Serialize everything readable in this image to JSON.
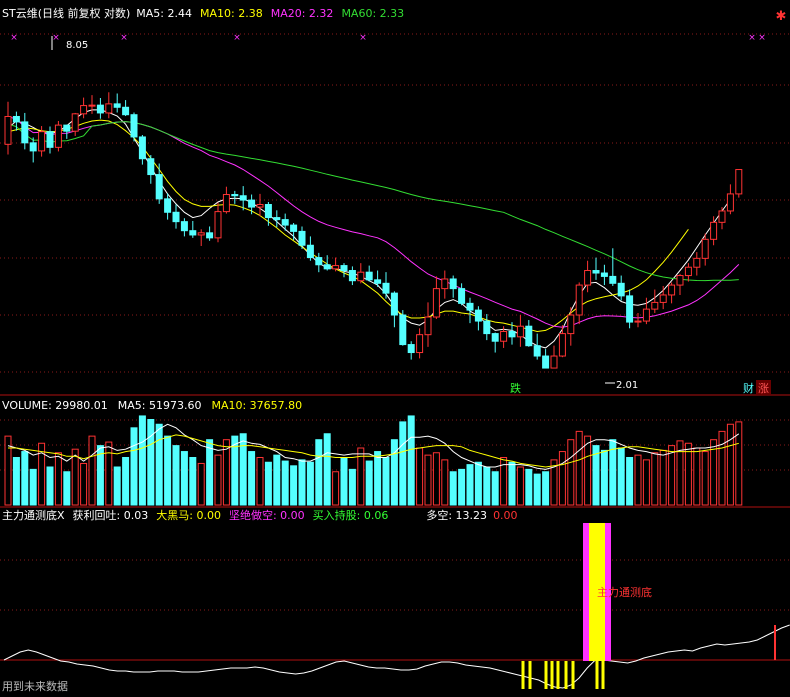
{
  "main_header": {
    "title": "ST云维(日线 前复权 对数)",
    "items": [
      {
        "label": "MA5: 2.44",
        "color": "#ffffff"
      },
      {
        "label": "MA10: 2.38",
        "color": "#ffff00"
      },
      {
        "label": "MA20: 2.32",
        "color": "#ff33ff"
      },
      {
        "label": "MA60: 2.33",
        "color": "#33dd33"
      }
    ]
  },
  "volume_header": {
    "items": [
      {
        "label": "VOLUME: 29980.01",
        "color": "#ffffff"
      },
      {
        "label": "MA5: 51973.60",
        "color": "#ffffff"
      },
      {
        "label": "MA10: 37657.80",
        "color": "#ffff00"
      }
    ]
  },
  "indicator_header": {
    "items": [
      {
        "label": "主力通测底X",
        "color": "#ffffff"
      },
      {
        "label": "获利回吐: 0.03",
        "color": "#ffffff"
      },
      {
        "label": "大黑马: 0.00",
        "color": "#ffff00"
      },
      {
        "label": "坚绝做空: 0.00",
        "color": "#ff33ff"
      },
      {
        "label": "买入持股: 0.06",
        "color": "#33ff33"
      },
      {
        "label": "多空: 13.23",
        "color": "#ffffff"
      },
      {
        "label": "0.00",
        "color": "#ff3333"
      }
    ]
  },
  "annotations": {
    "high_label": "8.05",
    "low_label": "2.01",
    "die_tag": "跌",
    "cai_tag": "财",
    "zhang_tag": "涨",
    "bar_label": "主力通测底",
    "footer": "用到未来数据"
  },
  "colors": {
    "up": "#ff3333",
    "down": "#54ffff",
    "ma5": "#ffffff",
    "ma10": "#ffff00",
    "ma20": "#ff33ff",
    "ma60": "#33dd33",
    "grid": "#8a1a1a",
    "divider": "#b01010",
    "magenta_bar": "#ff33ff",
    "yellow_bar": "#ffff00"
  },
  "chart_data": [
    {
      "type": "candlestick",
      "log_scale": true,
      "ylim": [
        1.9,
        8.6
      ],
      "candles": [
        [
          4.96,
          5.55,
          4.76,
          5.89
        ],
        [
          5.55,
          5.43,
          5.24,
          5.66
        ],
        [
          5.43,
          4.99,
          4.86,
          5.63
        ],
        [
          4.99,
          4.83,
          4.61,
          5.1
        ],
        [
          4.83,
          5.22,
          4.72,
          5.34
        ],
        [
          5.22,
          4.9,
          4.78,
          5.33
        ],
        [
          4.9,
          5.36,
          4.82,
          5.45
        ],
        [
          5.36,
          5.23,
          5.07,
          5.37
        ],
        [
          5.23,
          5.61,
          5.13,
          5.63
        ],
        [
          5.61,
          5.8,
          5.51,
          5.99
        ],
        [
          5.8,
          5.81,
          5.61,
          6.05
        ],
        [
          5.81,
          5.63,
          5.5,
          5.98
        ],
        [
          5.63,
          5.84,
          5.51,
          6.12
        ],
        [
          5.84,
          5.76,
          5.64,
          6.09
        ],
        [
          5.76,
          5.59,
          5.56,
          5.93
        ],
        [
          5.59,
          5.11,
          5.02,
          5.64
        ],
        [
          5.11,
          4.68,
          4.57,
          5.15
        ],
        [
          4.68,
          4.39,
          4.23,
          4.75
        ],
        [
          4.39,
          3.98,
          3.9,
          4.59
        ],
        [
          3.98,
          3.77,
          3.66,
          4.07
        ],
        [
          3.77,
          3.63,
          3.53,
          3.89
        ],
        [
          3.63,
          3.5,
          3.42,
          3.68
        ],
        [
          3.5,
          3.44,
          3.4,
          3.64
        ],
        [
          3.44,
          3.47,
          3.29,
          3.52
        ],
        [
          3.47,
          3.4,
          3.36,
          3.56
        ],
        [
          3.4,
          3.78,
          3.34,
          3.92
        ],
        [
          3.78,
          4.05,
          3.75,
          4.18
        ],
        [
          4.05,
          4.03,
          3.9,
          4.11
        ],
        [
          4.03,
          3.96,
          3.8,
          4.19
        ],
        [
          3.96,
          3.85,
          3.74,
          4.05
        ],
        [
          3.85,
          3.89,
          3.71,
          4.06
        ],
        [
          3.89,
          3.69,
          3.57,
          3.93
        ],
        [
          3.69,
          3.66,
          3.55,
          3.8
        ],
        [
          3.66,
          3.58,
          3.5,
          3.75
        ],
        [
          3.58,
          3.49,
          3.37,
          3.61
        ],
        [
          3.49,
          3.3,
          3.25,
          3.56
        ],
        [
          3.3,
          3.14,
          3.1,
          3.42
        ],
        [
          3.14,
          3.05,
          2.96,
          3.2
        ],
        [
          3.05,
          3.0,
          2.98,
          3.17
        ],
        [
          3.0,
          3.04,
          2.97,
          3.14
        ],
        [
          3.04,
          2.98,
          2.9,
          3.07
        ],
        [
          2.98,
          2.86,
          2.81,
          3.03
        ],
        [
          2.86,
          2.96,
          2.83,
          3.07
        ],
        [
          2.96,
          2.87,
          2.85,
          3.04
        ],
        [
          2.87,
          2.83,
          2.79,
          2.98
        ],
        [
          2.83,
          2.72,
          2.66,
          2.96
        ],
        [
          2.72,
          2.49,
          2.37,
          2.74
        ],
        [
          2.49,
          2.21,
          2.2,
          2.54
        ],
        [
          2.21,
          2.14,
          2.08,
          2.24
        ],
        [
          2.14,
          2.3,
          2.09,
          2.36
        ],
        [
          2.3,
          2.47,
          2.19,
          2.62
        ],
        [
          2.47,
          2.77,
          2.45,
          2.91
        ],
        [
          2.77,
          2.88,
          2.66,
          2.98
        ],
        [
          2.88,
          2.77,
          2.67,
          2.92
        ],
        [
          2.77,
          2.61,
          2.59,
          2.83
        ],
        [
          2.61,
          2.54,
          2.41,
          2.67
        ],
        [
          2.54,
          2.43,
          2.34,
          2.58
        ],
        [
          2.43,
          2.31,
          2.25,
          2.5
        ],
        [
          2.31,
          2.24,
          2.14,
          2.32
        ],
        [
          2.24,
          2.33,
          2.18,
          2.38
        ],
        [
          2.33,
          2.28,
          2.21,
          2.42
        ],
        [
          2.28,
          2.38,
          2.19,
          2.49
        ],
        [
          2.38,
          2.2,
          2.19,
          2.44
        ],
        [
          2.2,
          2.11,
          2.08,
          2.31
        ],
        [
          2.11,
          2.01,
          2.01,
          2.17
        ],
        [
          2.01,
          2.11,
          2.01,
          2.2
        ],
        [
          2.11,
          2.31,
          2.1,
          2.39
        ],
        [
          2.31,
          2.49,
          2.2,
          2.57
        ],
        [
          2.49,
          2.81,
          2.4,
          2.84
        ],
        [
          2.81,
          2.98,
          2.73,
          3.1
        ],
        [
          2.98,
          2.95,
          2.87,
          3.14
        ],
        [
          2.95,
          2.91,
          2.81,
          3.05
        ],
        [
          2.91,
          2.83,
          2.8,
          3.26
        ],
        [
          2.83,
          2.69,
          2.64,
          2.92
        ],
        [
          2.69,
          2.42,
          2.36,
          2.76
        ],
        [
          2.42,
          2.43,
          2.37,
          2.51
        ],
        [
          2.43,
          2.55,
          2.4,
          2.67
        ],
        [
          2.55,
          2.62,
          2.51,
          2.76
        ],
        [
          2.62,
          2.7,
          2.55,
          2.8
        ],
        [
          2.7,
          2.81,
          2.61,
          2.84
        ],
        [
          2.81,
          2.92,
          2.7,
          2.94
        ],
        [
          2.92,
          3.02,
          2.85,
          3.07
        ],
        [
          3.02,
          3.13,
          2.92,
          3.21
        ],
        [
          3.13,
          3.38,
          3.04,
          3.46
        ],
        [
          3.38,
          3.62,
          3.3,
          3.71
        ],
        [
          3.62,
          3.79,
          3.52,
          3.85
        ],
        [
          3.79,
          4.06,
          3.74,
          4.22
        ],
        [
          4.06,
          4.48,
          4.0,
          4.48
        ]
      ],
      "ma5": [
        5.3,
        5.45,
        5.4,
        5.31,
        5.21,
        5.18,
        5.22,
        5.35,
        5.5,
        5.64,
        5.7,
        5.7,
        5.64,
        5.56,
        5.38,
        5.08,
        4.81,
        4.53,
        4.27,
        4.06,
        3.9,
        3.77,
        3.69,
        3.72,
        3.83,
        3.93,
        3.98,
        3.99,
        3.98,
        3.92,
        3.83,
        3.74,
        3.63,
        3.52,
        3.42,
        3.29,
        3.17,
        3.07,
        3.01,
        3.01,
        2.97,
        2.95,
        2.91,
        2.86,
        2.81,
        2.71,
        2.58,
        2.46,
        2.41,
        2.39,
        2.44,
        2.55,
        2.62,
        2.65,
        2.61,
        2.53,
        2.48,
        2.4,
        2.34,
        2.35,
        2.34,
        2.3,
        2.24,
        2.2,
        2.18,
        2.24,
        2.35,
        2.53,
        2.7,
        2.83,
        2.84,
        2.78,
        2.7,
        2.63,
        2.6,
        2.59,
        2.61,
        2.67,
        2.75,
        2.86,
        2.98,
        3.11,
        3.27,
        3.44,
        3.61,
        3.79,
        3.97
      ],
      "ma10": [
        5.22,
        5.26,
        5.3,
        5.28,
        5.24,
        5.22,
        5.23,
        5.27,
        5.33,
        5.4,
        5.45,
        5.47,
        5.45,
        5.37,
        5.24,
        5.09,
        4.91,
        4.69,
        4.48,
        4.27,
        4.1,
        3.97,
        3.9,
        3.86,
        3.86,
        3.88,
        3.89,
        3.88,
        3.84,
        3.79,
        3.72,
        3.63,
        3.54,
        3.44,
        3.36,
        3.28,
        3.2,
        3.13,
        3.06,
        3.0,
        2.95,
        2.91,
        2.86,
        2.79,
        2.72,
        2.63,
        2.55,
        2.49,
        2.46,
        2.46,
        2.47,
        2.5,
        2.53,
        2.53,
        2.51,
        2.5,
        2.47,
        2.44,
        2.42,
        2.41,
        2.39,
        2.37,
        2.35,
        2.33,
        2.34,
        2.38,
        2.44,
        2.51,
        2.58,
        2.63,
        2.66,
        2.68,
        2.7,
        2.72,
        2.75,
        2.8,
        2.87,
        2.97,
        3.08,
        3.21,
        3.36,
        3.52
      ]
    },
    {
      "type": "bar",
      "title": "VOLUME",
      "values": [
        58,
        40,
        45,
        30,
        52,
        32,
        44,
        28,
        47,
        35,
        58,
        50,
        53,
        32,
        40,
        65,
        75,
        72,
        68,
        58,
        50,
        45,
        40,
        35,
        55,
        42,
        55,
        58,
        60,
        45,
        40,
        36,
        42,
        37,
        33,
        38,
        36,
        55,
        60,
        28,
        40,
        30,
        48,
        37,
        45,
        40,
        55,
        70,
        75,
        48,
        42,
        44,
        38,
        28,
        30,
        34,
        36,
        32,
        28,
        40,
        36,
        32,
        30,
        26,
        28,
        38,
        45,
        55,
        62,
        58,
        50,
        46,
        55,
        48,
        40,
        42,
        38,
        44,
        46,
        50,
        54,
        52,
        48,
        45,
        55,
        62,
        68,
        70
      ],
      "ma5": [
        50,
        48,
        46,
        42,
        44,
        40,
        41,
        37,
        42,
        37,
        42,
        48,
        49,
        46,
        47,
        50,
        53,
        58,
        64,
        68,
        65,
        59,
        55,
        50,
        48,
        46,
        47,
        51,
        54,
        52,
        51,
        48,
        45,
        40,
        39,
        37,
        37,
        40,
        44,
        43,
        42,
        43,
        43,
        43,
        40,
        40,
        44,
        51,
        57,
        57,
        58,
        56,
        52,
        45,
        40,
        37,
        34,
        32,
        32,
        34,
        34,
        34,
        33,
        31,
        30,
        32,
        35,
        40,
        46,
        52,
        55,
        55,
        54,
        51,
        48,
        46,
        45,
        43,
        42,
        44,
        46,
        47,
        48,
        48,
        49,
        51,
        55,
        60
      ],
      "ma10": [
        48,
        48,
        47,
        46,
        45,
        44,
        43,
        41,
        41,
        39,
        41,
        43,
        44,
        43,
        45,
        46,
        48,
        51,
        55,
        57,
        59,
        58,
        56,
        54,
        52,
        50,
        49,
        49,
        50,
        50,
        49,
        48,
        47,
        46,
        45,
        44,
        42,
        41,
        41,
        40,
        40,
        40,
        41,
        41,
        41,
        42,
        43,
        45,
        47,
        48,
        49,
        50,
        50,
        50,
        49,
        46,
        44,
        42,
        40,
        38,
        37,
        35,
        34,
        33,
        32,
        33,
        34,
        36,
        38,
        41,
        43,
        45,
        47,
        48,
        49,
        49,
        48,
        47,
        46,
        45,
        45,
        45,
        45,
        46,
        47,
        48,
        50,
        52
      ]
    }
  ]
}
